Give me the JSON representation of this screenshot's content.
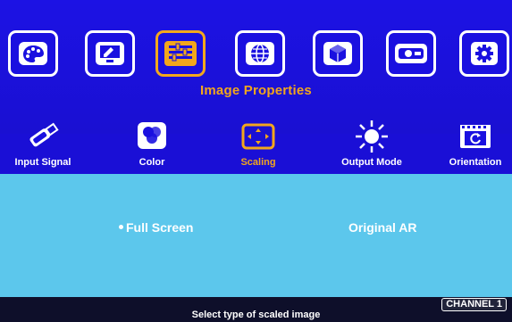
{
  "header": {
    "active_tab_title": "Image Properties",
    "tabs": [
      {
        "icon": "palette-icon"
      },
      {
        "icon": "display-settings-icon"
      },
      {
        "icon": "image-properties-icon"
      },
      {
        "icon": "globe-icon"
      },
      {
        "icon": "cube-icon"
      },
      {
        "icon": "projector-icon"
      },
      {
        "icon": "gear-icon"
      }
    ]
  },
  "subtabs": [
    {
      "label": "Input Signal",
      "icon": "usb-plug-icon"
    },
    {
      "label": "Color",
      "icon": "color-circles-icon"
    },
    {
      "label": "Scaling",
      "icon": "scaling-icon"
    },
    {
      "label": "Output Mode",
      "icon": "sun-burst-icon"
    },
    {
      "label": "Orientation",
      "icon": "rotate-icon"
    }
  ],
  "options": {
    "full_screen": "Full Screen",
    "original_ar": "Original AR",
    "selected": "Full Screen"
  },
  "status": {
    "hint": "Select type of scaled image",
    "channel": "CHANNEL 1"
  },
  "colors": {
    "background": "#1a0fd6",
    "accent": "#f2a61c",
    "content": "#5cc7ec",
    "status_bar": "#0e0f2a"
  }
}
